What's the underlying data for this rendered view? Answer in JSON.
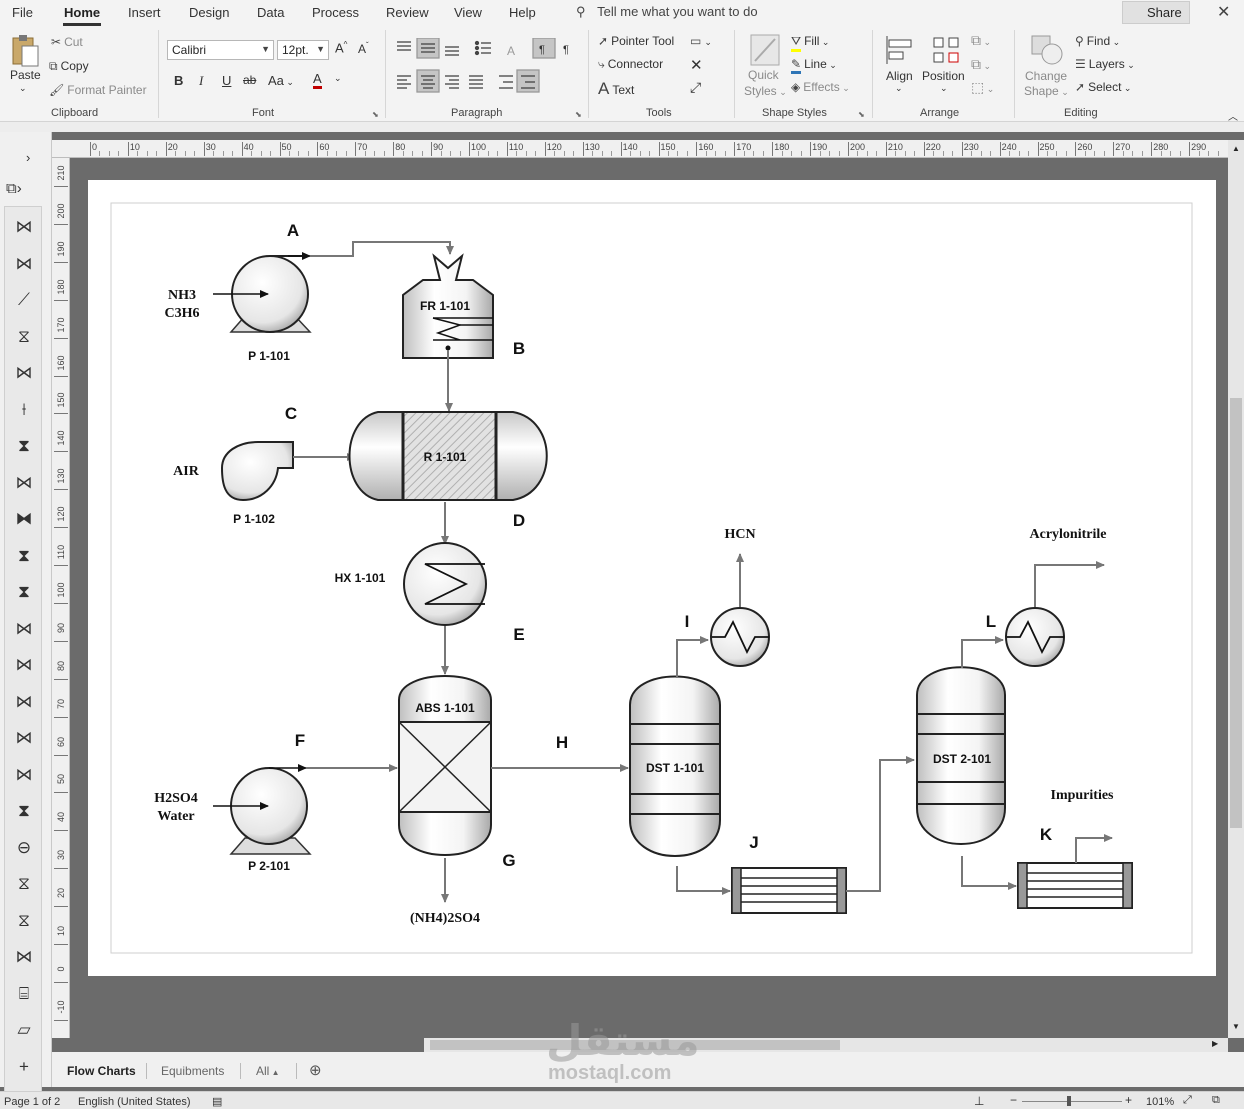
{
  "menu": {
    "items": [
      "File",
      "Home",
      "Insert",
      "Design",
      "Data",
      "Process",
      "Review",
      "View",
      "Help"
    ],
    "active": "Home"
  },
  "tellme": "Tell me what you want to do",
  "share": "Share",
  "ribbon": {
    "clipboard": {
      "paste": "Paste",
      "cut": "Cut",
      "copy": "Copy",
      "format_painter": "Format Painter",
      "label": "Clipboard"
    },
    "font": {
      "name": "Calibri",
      "size": "12pt.",
      "bold": "B",
      "italic": "I",
      "underline": "U",
      "strike": "ab",
      "case": "Aa",
      "color": "A",
      "grow": "A",
      "shrink": "A",
      "label": "Font"
    },
    "paragraph": {
      "label": "Paragraph"
    },
    "tools": {
      "pointer": "Pointer Tool",
      "connector": "Connector",
      "text": "Text",
      "label": "Tools"
    },
    "shape_styles": {
      "quick": "Quick",
      "styles": "Styles",
      "fill": "Fill",
      "line": "Line",
      "effects": "Effects",
      "label": "Shape Styles"
    },
    "arrange": {
      "align": "Align",
      "position": "Position",
      "label": "Arrange"
    },
    "editing": {
      "change": "Change",
      "shape": "Shape",
      "find": "Find",
      "layers": "Layers",
      "select": "Select",
      "label": "Editing"
    }
  },
  "hruler_ticks": [
    "0",
    "10",
    "20",
    "30",
    "40",
    "50",
    "60",
    "70",
    "80",
    "90",
    "100",
    "110",
    "120",
    "130",
    "140",
    "150",
    "160",
    "170",
    "180",
    "190",
    "200",
    "210",
    "220",
    "230",
    "240",
    "250",
    "260",
    "270",
    "280",
    "290"
  ],
  "vruler_ticks": [
    "210",
    "200",
    "190",
    "180",
    "170",
    "160",
    "150",
    "140",
    "130",
    "120",
    "110",
    "100",
    "90",
    "80",
    "70",
    "60",
    "50",
    "40",
    "30",
    "20",
    "10",
    "0",
    "-10"
  ],
  "diagram": {
    "equipment": {
      "p1": "P 1-101",
      "fr": "FR 1-101",
      "p2": "P 1-102",
      "reactor": "R 1-101",
      "hx": "HX 1-101",
      "abs": "ABS 1-101",
      "p3": "P 2-101",
      "dst1": "DST 1-101",
      "dst2": "DST 2-101"
    },
    "streams": {
      "A": "A",
      "B": "B",
      "C": "C",
      "D": "D",
      "E": "E",
      "F": "F",
      "G": "G",
      "H": "H",
      "I": "I",
      "J": "J",
      "K": "K",
      "L": "L"
    },
    "feeds": {
      "nh3": "NH3",
      "c3h6": "C3H6",
      "air": "AIR",
      "h2so4": "H2SO4",
      "water": "Water"
    },
    "products": {
      "hcn": "HCN",
      "acrylonitrile": "Acrylonitrile",
      "impurities": "Impurities",
      "ammonium_sulfate": "(NH4)2SO4"
    }
  },
  "tabs": {
    "flow_charts": "Flow Charts",
    "equipments": "Equibments",
    "all": "All"
  },
  "status": {
    "page": "Page 1 of 2",
    "language": "English (United States)",
    "zoom": "101%"
  },
  "watermark": {
    "arabic": "مستقل",
    "latin": "mostaql.com"
  }
}
